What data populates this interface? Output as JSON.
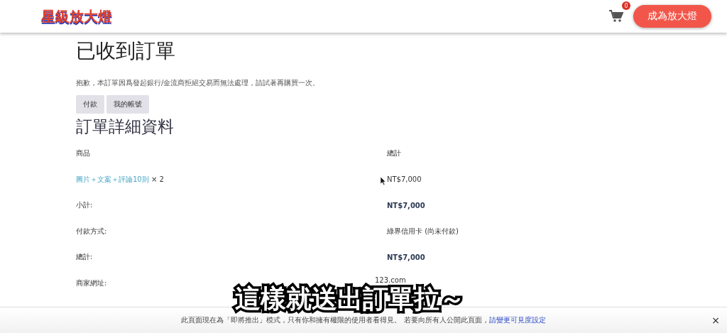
{
  "header": {
    "logo": "星級放大燈",
    "cart_count": "0",
    "cta": "成為放大燈"
  },
  "page": {
    "title": "已收到訂單",
    "notice": "抱歉，本訂單因爲發起銀行/金流商拒絕交易而無法處理，請試著再購買一次。",
    "buttons": [
      "付款",
      "我的帳號"
    ]
  },
  "order_details": {
    "heading": "訂單詳細資料",
    "columns": [
      "商品",
      "總計"
    ],
    "rows": [
      {
        "kind": "product",
        "label": "圖片＋文案＋評論10則",
        "qty": "× 2",
        "value": "NT$7,000"
      },
      {
        "kind": "total",
        "label": "小計:",
        "value": "NT$7,000"
      },
      {
        "kind": "plain",
        "label": "付款方式:",
        "value": "綠界信用卡 (尚未付款)"
      },
      {
        "kind": "total",
        "label": "總計:",
        "value": "NT$7,000"
      },
      {
        "kind": "meta",
        "label": "商家網址:",
        "value": "123.com"
      }
    ]
  },
  "caption": "這樣就送出訂單拉～",
  "banner": {
    "text": "此頁面現在為「即將推出」模式，只有你和擁有權限的使用者看得見。 若要向所有人公開此頁面，",
    "link": "請變更可見度設定",
    "close": "×"
  }
}
